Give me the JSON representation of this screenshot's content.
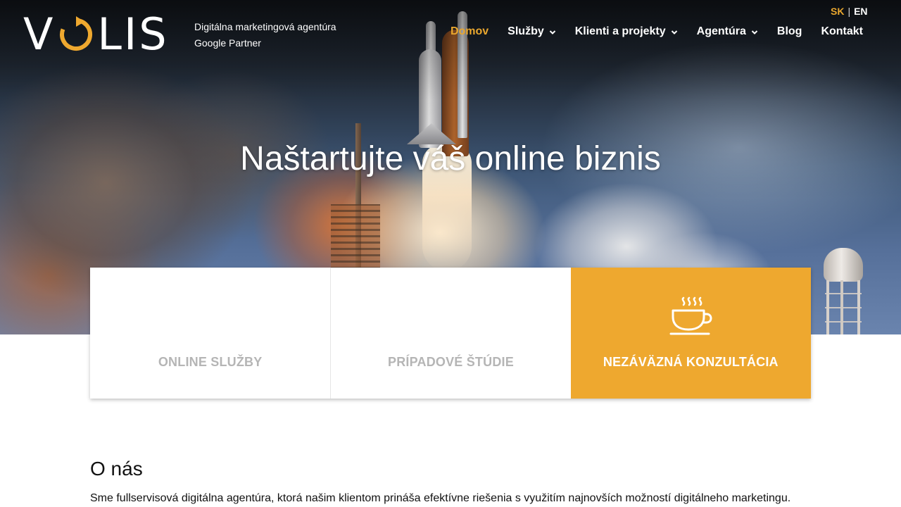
{
  "header": {
    "logo_text": "VOLIS",
    "tagline_line1": "Digitálna marketingová agentúra",
    "tagline_line2": "Google Partner",
    "languages": {
      "active": "SK",
      "other": "EN"
    },
    "nav": [
      {
        "label": "Domov",
        "active": true
      },
      {
        "label": "Služby",
        "dropdown": true
      },
      {
        "label": "Klienti a projekty",
        "dropdown": true
      },
      {
        "label": "Agentúra",
        "dropdown": true
      },
      {
        "label": "Blog"
      },
      {
        "label": "Kontakt"
      }
    ]
  },
  "hero": {
    "title": "Naštartujte váš online biznis",
    "image": "space-shuttle-launch"
  },
  "cards": [
    {
      "label": "ONLINE SLUŽBY"
    },
    {
      "label": "PRÍPADOVÉ ŠTÚDIE"
    },
    {
      "label": "NEZÁVÄZNÁ KONZULTÁCIA",
      "icon": "coffee-cup-icon"
    }
  ],
  "about": {
    "title": "O nás",
    "text": "Sme fullservisová digitálna agentúra, ktorá našim klientom prináša efektívne riešenia s využitím najnovších možností digitálneho marketingu."
  },
  "colors": {
    "accent": "#eea82f",
    "nav_active": "#eaa72e",
    "card_label_muted": "#b5b5b5"
  }
}
